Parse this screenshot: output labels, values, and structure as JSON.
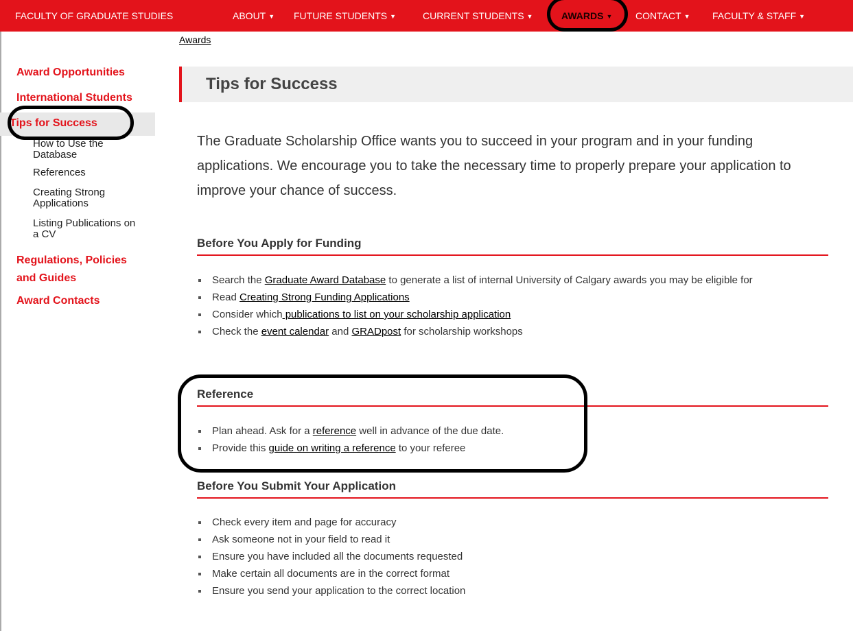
{
  "nav": {
    "brand": "FACULTY OF GRADUATE STUDIES",
    "items": [
      "ABOUT",
      "FUTURE STUDENTS",
      "CURRENT STUDENTS",
      "AWARDS",
      "CONTACT",
      "FACULTY & STAFF"
    ],
    "caret": "▼"
  },
  "breadcrumb": "Awards",
  "sidebar": {
    "main": [
      "Award Opportunities",
      "International Students",
      "Tips for Success"
    ],
    "sub": [
      "How to Use the Database",
      "References",
      "Creating Strong Applications",
      "Listing Publications on a CV"
    ],
    "regulations": "Regulations, Policies and Guides",
    "contacts": "Award Contacts"
  },
  "page": {
    "title": "Tips for Success",
    "intro": "The Graduate Scholarship Office wants you to succeed in your program and in your funding applications. We encourage you to take the necessary time to properly prepare your application to improve your chance of success."
  },
  "sections": {
    "apply": {
      "heading": "Before You Apply for Funding",
      "b1": {
        "pre": "Search the ",
        "link": "Graduate Award Database",
        "post": " to generate a list of internal University of Calgary awards you may be eligible for"
      },
      "b2": {
        "pre": "Read ",
        "link": "Creating Strong Funding Applications",
        "post": ""
      },
      "b3": {
        "pre": "Consider which",
        "link": " publications to list on your scholarship application",
        "post": ""
      },
      "b4": {
        "pre": "Check the ",
        "link": "event calendar",
        "mid": " and ",
        "link2": "GRADpost",
        "post": " for scholarship workshops"
      }
    },
    "reference": {
      "heading": "Reference",
      "b1": {
        "pre": "Plan ahead. Ask for a ",
        "link": "reference",
        "post": " well in advance of the due date."
      },
      "b2": {
        "pre": "Provide this ",
        "link": "guide on writing a reference",
        "post": " to your referee"
      }
    },
    "submit": {
      "heading": "Before You Submit Your Application",
      "items": [
        "Check every item and page for accuracy",
        "Ask someone not in your field to read it",
        "Ensure you have included all the documents requested",
        "Make certain all documents are in the correct format",
        "Ensure you send your application to the correct location"
      ]
    }
  }
}
